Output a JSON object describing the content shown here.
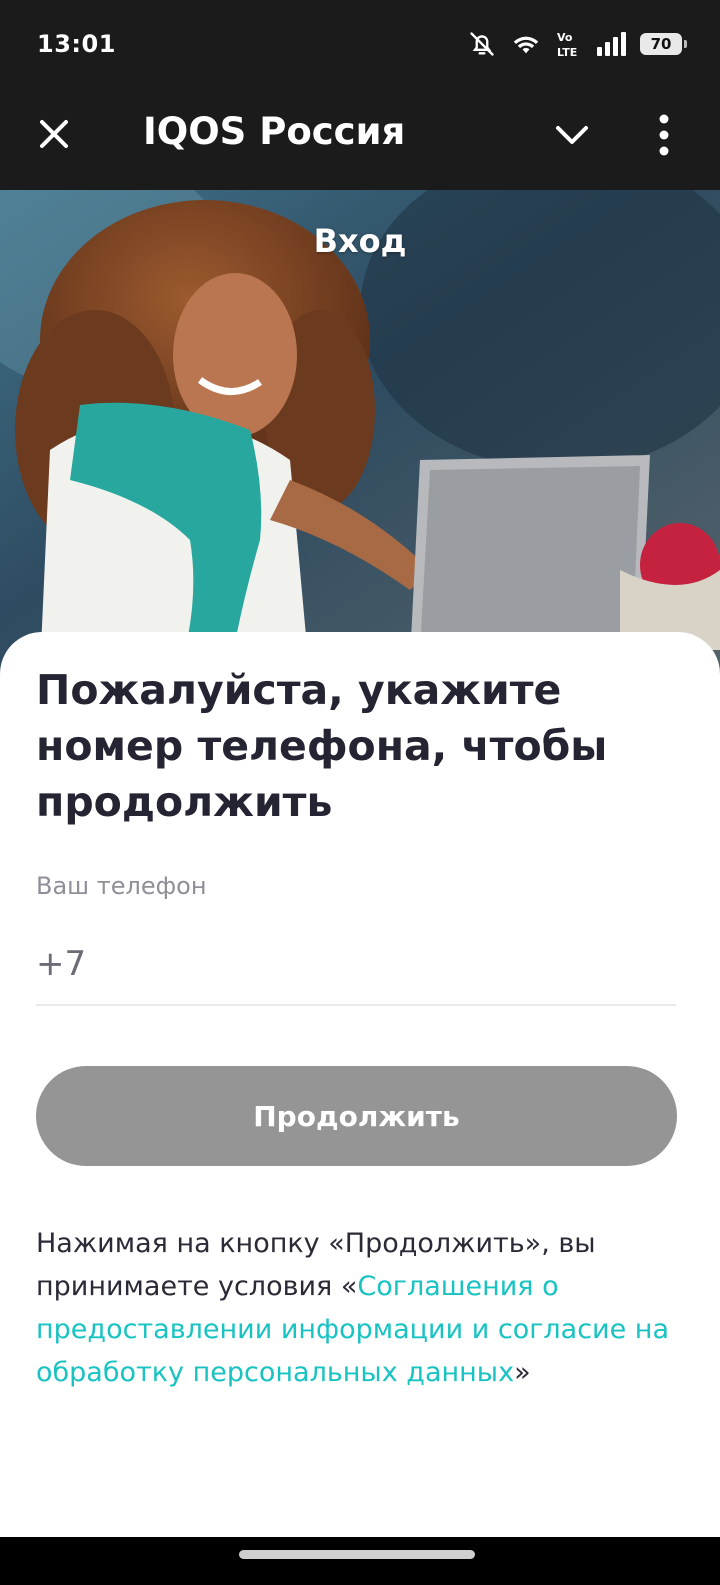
{
  "status_bar": {
    "time": "13:01",
    "battery": "70",
    "icons": [
      "bell-off-icon",
      "wifi-icon",
      "volte-icon",
      "signal-icon",
      "battery-icon"
    ]
  },
  "app_bar": {
    "title": "IQOS Россия",
    "icons": [
      "close-icon",
      "chevron-down-icon",
      "more-vert-icon"
    ]
  },
  "hero": {
    "title": "Вход"
  },
  "form": {
    "headline": "Пожалуйста, укажите номер телефона, чтобы продолжить",
    "phone_label": "Ваш телефон",
    "phone_placeholder": "+7",
    "continue_label": "Продолжить",
    "consent_prefix": "Нажимая на кнопку «Продолжить», вы принимаете условия «",
    "consent_link": "Соглашения о предоставлении информации и согласие на обработку персональных данных",
    "consent_suffix": "»"
  },
  "colors": {
    "accent": "#19c3c2",
    "button_disabled": "#959595",
    "headline": "#242433"
  }
}
